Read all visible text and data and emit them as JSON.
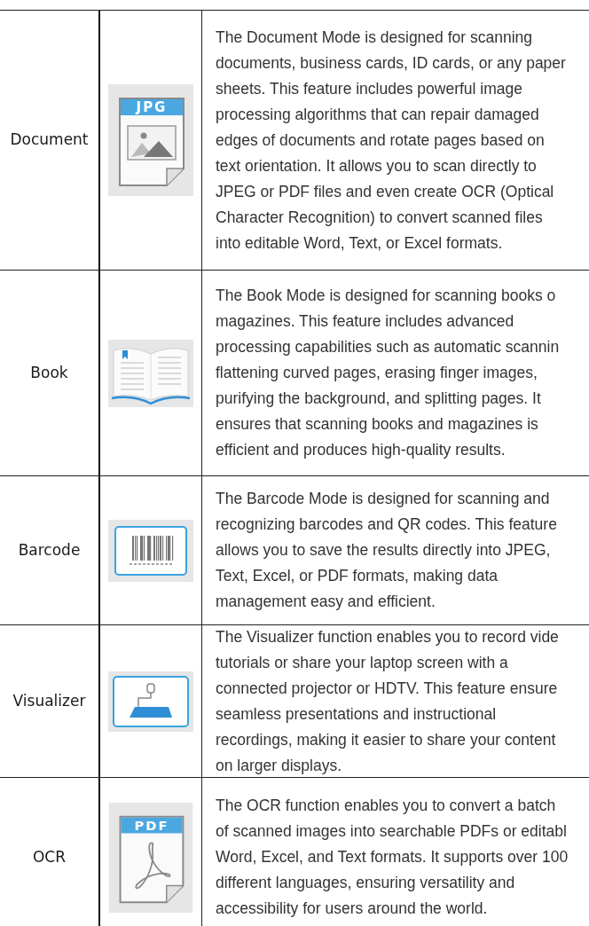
{
  "rows": [
    {
      "mode": "Document",
      "icon": {
        "kind": "file",
        "label": "JPG"
      },
      "description": "The Document Mode is designed for scanning\ndocuments, business cards, ID cards, or any paper\nsheets. This feature includes powerful image\nprocessing algorithms that can repair damaged\nedges of documents and rotate pages based on\ntext orientation. It allows you to scan directly to\nJPEG or PDF files and even create OCR (Optical\nCharacter Recognition) to convert scanned files\ninto editable Word, Text, or Excel formats."
    },
    {
      "mode": "Book",
      "icon": {
        "kind": "book"
      },
      "description": "The Book Mode is designed for scanning books o\nmagazines. This feature includes advanced\nprocessing capabilities such as automatic scannin\nflattening curved pages, erasing finger images,\npurifying the background, and splitting pages. It\nensures that scanning books and magazines is\nefficient and produces high-quality results."
    },
    {
      "mode": "Barcode",
      "icon": {
        "kind": "barcode"
      },
      "description": "The Barcode Mode is designed for scanning and\nrecognizing barcodes and QR codes. This feature\nallows you to save the results directly into JPEG,\nText, Excel, or PDF formats, making data\nmanagement easy and efficient."
    },
    {
      "mode": "Visualizer",
      "icon": {
        "kind": "visualizer"
      },
      "description": "The Visualizer function enables you to record vide\ntutorials or share your laptop screen with a\nconnected projector or HDTV. This feature ensure\nseamless presentations and instructional\nrecordings, making it easier to share your content\non larger displays."
    },
    {
      "mode": "OCR",
      "icon": {
        "kind": "pdf",
        "label": "PDF"
      },
      "description": "The OCR function enables you to convert a batch\nof scanned images into searchable PDFs or editabl\nWord, Excel, and Text formats. It supports over 100\ndifferent languages, ensuring versatility and\naccessibility for users around the world."
    }
  ]
}
